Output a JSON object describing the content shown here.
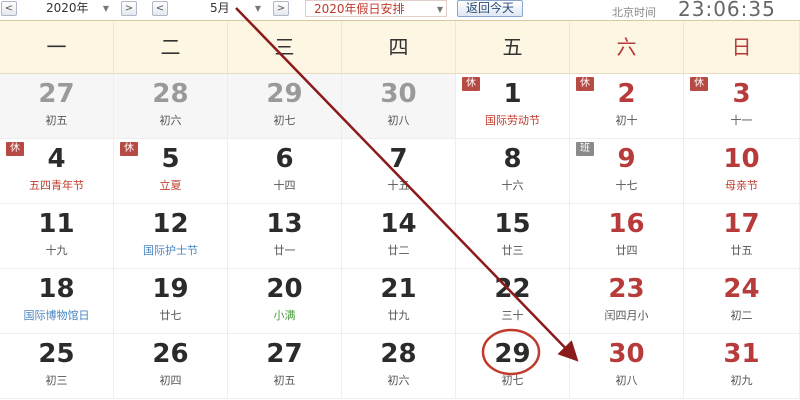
{
  "toolbar": {
    "prev_year": "<",
    "year_value": "2020年",
    "next_year": ">",
    "prev_month": "<",
    "month_value": "5月",
    "next_month": ">",
    "holiday_select": "2020年假日安排",
    "today_button": "返回今天",
    "beijing_time_label": "北京时间",
    "beijing_time": "23:06:35"
  },
  "weekdays": [
    "一",
    "二",
    "三",
    "四",
    "五",
    "六",
    "日"
  ],
  "weeks": [
    [
      {
        "day": "27",
        "sub": "初五",
        "other": true
      },
      {
        "day": "28",
        "sub": "初六",
        "other": true
      },
      {
        "day": "29",
        "sub": "初七",
        "other": true
      },
      {
        "day": "30",
        "sub": "初八",
        "other": true
      },
      {
        "day": "1",
        "sub": "国际劳动节",
        "tag": "休",
        "subStyle": "hol"
      },
      {
        "day": "2",
        "sub": "初十",
        "tag": "休",
        "red": true
      },
      {
        "day": "3",
        "sub": "十一",
        "tag": "休",
        "red": true
      }
    ],
    [
      {
        "day": "4",
        "sub": "五四青年节",
        "tag": "休",
        "subStyle": "hol"
      },
      {
        "day": "5",
        "sub": "立夏",
        "tag": "休",
        "subStyle": "hol"
      },
      {
        "day": "6",
        "sub": "十四"
      },
      {
        "day": "7",
        "sub": "十五"
      },
      {
        "day": "8",
        "sub": "十六"
      },
      {
        "day": "9",
        "sub": "十七",
        "tag": "班",
        "tagStyle": "work",
        "red": true
      },
      {
        "day": "10",
        "sub": "母亲节",
        "red": true,
        "subStyle": "hol"
      }
    ],
    [
      {
        "day": "11",
        "sub": "十九"
      },
      {
        "day": "12",
        "sub": "国际护士节",
        "subStyle": "blue"
      },
      {
        "day": "13",
        "sub": "廿一"
      },
      {
        "day": "14",
        "sub": "廿二"
      },
      {
        "day": "15",
        "sub": "廿三"
      },
      {
        "day": "16",
        "sub": "廿四",
        "red": true
      },
      {
        "day": "17",
        "sub": "廿五",
        "red": true
      }
    ],
    [
      {
        "day": "18",
        "sub": "国际博物馆日",
        "subStyle": "blue"
      },
      {
        "day": "19",
        "sub": "廿七"
      },
      {
        "day": "20",
        "sub": "小满",
        "subStyle": "green"
      },
      {
        "day": "21",
        "sub": "廿九"
      },
      {
        "day": "22",
        "sub": "三十"
      },
      {
        "day": "23",
        "sub": "闰四月小",
        "red": true
      },
      {
        "day": "24",
        "sub": "初二",
        "red": true
      }
    ],
    [
      {
        "day": "25",
        "sub": "初三"
      },
      {
        "day": "26",
        "sub": "初四"
      },
      {
        "day": "27",
        "sub": "初五"
      },
      {
        "day": "28",
        "sub": "初六"
      },
      {
        "day": "29",
        "sub": "初七"
      },
      {
        "day": "30",
        "sub": "初八",
        "red": true
      },
      {
        "day": "31",
        "sub": "初九",
        "red": true
      }
    ]
  ],
  "colors": {
    "holiday_red": "#b83b3b",
    "annotation_arrow": "#8b1a1a",
    "circle": "#c0392b",
    "header_bg": "#fdf6e3"
  }
}
